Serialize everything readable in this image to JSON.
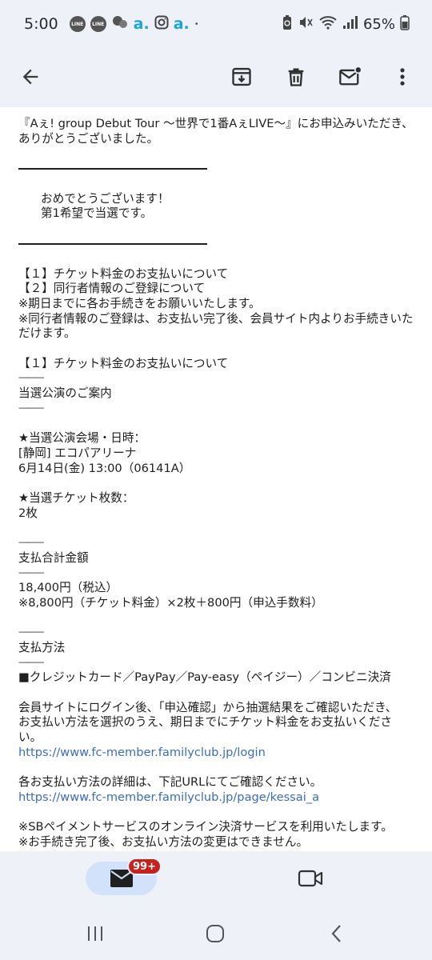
{
  "status_bar": {
    "time": "5:00",
    "app_icons": [
      "LINE",
      "LINE"
    ],
    "a_icon_1": "a.",
    "a_icon_2": "a.",
    "dot": "•",
    "battery": "65%"
  },
  "app_bar": {
    "back_icon": "arrow-back-icon",
    "archive_icon": "archive-icon",
    "delete_icon": "trash-icon",
    "unread_icon": "mark-unread-icon",
    "more_icon": "more-vert-icon"
  },
  "message": {
    "intro_1": "『Aぇ! group Debut Tour 〜世界で1番AぇLIVE〜』にお申込みいただき、",
    "intro_2": "ありがとうございました。",
    "congrats_1": "おめでとうございます！",
    "congrats_2": "第1希望で当選です。",
    "toc_1": "【１】チケット料金のお支払いについて",
    "toc_2": "【２】同行者情報のご登録について",
    "note_1": "※期日までに各お手続きをお願いいたします。",
    "note_2a": "※同行者情報のご登録は、お支払い完了後、会員サイト内よりお手続きいた",
    "note_2b": "だけます。",
    "section_1_title": "【１】チケット料金のお支払いについて",
    "dashes": "------------",
    "venue_heading": "当選公演のご案内",
    "venue_label": "★当選公演会場・日時：",
    "venue_name": "[静岡] エコパアリーナ",
    "venue_datetime": "6月14日(金) 13:00（06141A）",
    "tickets_label": "★当選チケット枚数：",
    "tickets_value": "2枚",
    "total_heading": "支払合計金額",
    "total_value": "18,400円（税込）",
    "total_breakdown": "※8,800円（チケット料金）×2枚＋800円（申込手数料）",
    "method_heading": "支払方法",
    "method_value": "■クレジットカード／PayPay／Pay-easy（ペイジー）／コンビニ決済",
    "login_text_1": "会員サイトにログイン後、「申込確認」から抽選結果をご確認いただき、",
    "login_text_2": "お支払い方法を選択のうえ、期日までにチケット料金をお支払いくださ",
    "login_text_3": "い。",
    "login_link": "https://www.fc-member.familyclub.jp/login",
    "details_text": "各お支払い方法の詳細は、下記URLにてご確認ください。",
    "details_link": "https://www.fc-member.familyclub.jp/page/kessai_a",
    "sb_note": "※SBペイメントサービスのオンライン決済サービスを利用いたします。",
    "change_note": "※お手続き完了後、お支払い方法の変更はできません。"
  },
  "bottom_nav": {
    "mail_badge": "99+",
    "mail_icon": "mail-icon",
    "meet_icon": "video-camera-icon"
  },
  "colors": {
    "link": "#3a6cc8",
    "badge": "#c5221f",
    "mail_pill": "#d3e2fb",
    "chrome_bg": "#eef1f8"
  }
}
